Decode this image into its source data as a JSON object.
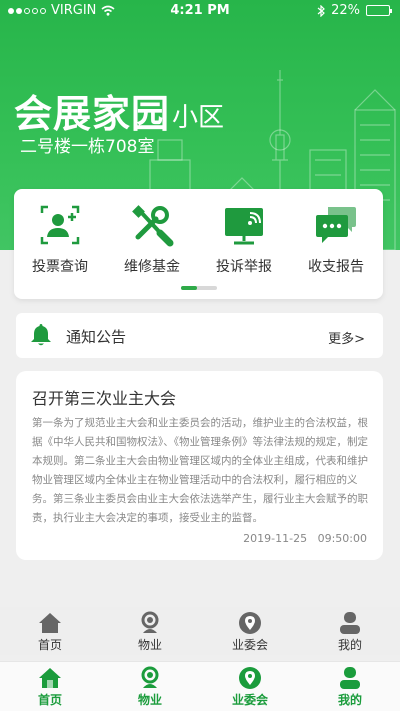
{
  "status_bar": {
    "carrier": "VIRGIN",
    "time": "4:21 PM",
    "battery": "22%",
    "battery_level": 0.22
  },
  "header": {
    "title": "会展家园",
    "subtitle": "小区",
    "address": "二号楼一栋708室"
  },
  "menu": {
    "items": [
      {
        "label": "投票查询",
        "icon": "vote-person-icon"
      },
      {
        "label": "维修基金",
        "icon": "wrench-screwdriver-icon"
      },
      {
        "label": "投诉举报",
        "icon": "monitor-complaint-icon"
      },
      {
        "label": "收支报告",
        "icon": "chat-bubble-report-icon"
      }
    ]
  },
  "notice": {
    "title": "通知公告",
    "more": "更多>"
  },
  "article": {
    "title": "召开第三次业主大会",
    "body": "第一条为了规范业主大会和业主委员会的活动，维护业主的合法权益，根据《中华人民共和国物权法》、《物业管理条例》等法律法规的规定，制定本规则。第二条业主大会由物业管理区域内的全体业主组成，代表和维护物业管理区域内全体业主在物业管理活动中的合法权利，履行相应的义务。第三条业主委员会由业主大会依法选举产生，履行业主大会赋予的职责，执行业主大会决定的事项，接受业主的监督。",
    "date": "2019-11-25",
    "time": "09:50:00"
  },
  "tabbar_upper": [
    {
      "label": "首页",
      "icon": "home-icon"
    },
    {
      "label": "物业",
      "icon": "property-icon"
    },
    {
      "label": "业委会",
      "icon": "location-pin-icon"
    },
    {
      "label": "我的",
      "icon": "user-icon"
    }
  ],
  "tabbar_lower": [
    {
      "label": "首页",
      "icon": "home-icon"
    },
    {
      "label": "物业",
      "icon": "property-icon"
    },
    {
      "label": "业委会",
      "icon": "location-pin-icon"
    },
    {
      "label": "我的",
      "icon": "user-icon"
    }
  ],
  "colors": {
    "brand_green": "#2faa49",
    "tab_active": "#1b9c3c",
    "tab_inactive": "#666666"
  }
}
